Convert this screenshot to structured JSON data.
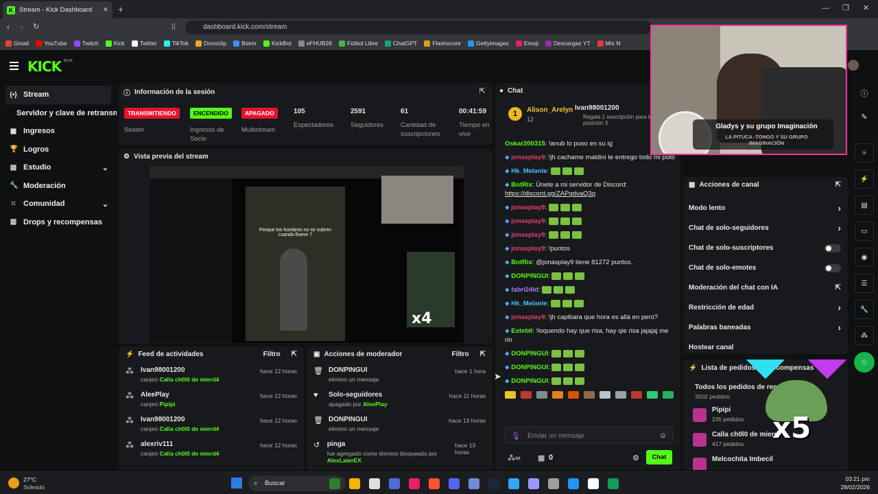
{
  "browser": {
    "tab_title": "Stream - Kick Dashboard",
    "url": "dashboard.kick.com/stream",
    "bookmarks": [
      "Gmail",
      "YouTube",
      "Twitch",
      "Kick",
      "Twitter",
      "TikTok",
      "Donoclip",
      "Botrix",
      "KickBot",
      "eFHUB26",
      "Fútbol Libre",
      "ChatGPT",
      "Flashscore",
      "Gettyimages",
      "Emoji",
      "Descargas YT",
      "Mix N"
    ]
  },
  "brand": {
    "logo": "KICK",
    "beta": "BETA"
  },
  "sidebar": {
    "items": [
      {
        "label": "Stream",
        "icon": "(•)"
      },
      {
        "label": "Servidor y clave de retransmisión",
        "icon": ""
      },
      {
        "label": "Ingresos",
        "icon": "▦"
      },
      {
        "label": "Logros",
        "icon": "🏆"
      },
      {
        "label": "Estudio",
        "icon": "▤"
      },
      {
        "label": "Moderación",
        "icon": "🔧"
      },
      {
        "label": "Comunidad",
        "icon": "⁙"
      },
      {
        "label": "Drops y recompensas",
        "icon": "▥"
      }
    ]
  },
  "session": {
    "title": "Información de la sesión",
    "stats": [
      {
        "badge": "TRANSMITIENDO",
        "label": "Sesión"
      },
      {
        "badge": "ENCENDIDO",
        "label": "Ingresos de Socio"
      },
      {
        "badge": "APAGADO",
        "label": "Multistream"
      },
      {
        "value": "105",
        "label": "Espectadores"
      },
      {
        "value": "2591",
        "label": "Seguidores"
      },
      {
        "value": "61",
        "label": "Cantidad de suscripciones"
      },
      {
        "value": "00:41:59",
        "label": "Tiempo en vivo"
      }
    ]
  },
  "preview": {
    "title": "Vista previa del stream",
    "caption": "Porque los hombres no se cubren cuando llueve ?",
    "overlay": "x4"
  },
  "feed": {
    "title": "Feed de actividades",
    "filter": "Filtro",
    "items": [
      {
        "user": "Ivan98001200",
        "action": "canjeó",
        "reward": "Calla ch0l0 de mierd4",
        "time": "hace 12 horas"
      },
      {
        "user": "AleePlay",
        "action": "canjeó",
        "reward": "Pipipi",
        "time": "hace 12 horas"
      },
      {
        "user": "Ivan98001200",
        "action": "canjeó",
        "reward": "Calla ch0l0 de mierd4",
        "time": "hace 12 horas"
      },
      {
        "user": "alexriv111",
        "action": "canjeó",
        "reward": "Calla ch0l0 de mierd4",
        "time": "hace 12 horas"
      }
    ]
  },
  "mod": {
    "title": "Acciones de moderador",
    "filter": "Filtro",
    "items": [
      {
        "title": "DONPINGUI",
        "sub": "eliminó un mensaje",
        "by": "",
        "time": "hace 1 hora",
        "icon": "🗑"
      },
      {
        "title": "Solo-seguidores",
        "sub": "apagado por",
        "by": "AleePlay",
        "time": "hace 11 horas",
        "icon": "♥"
      },
      {
        "title": "DONPINGUI",
        "sub": "eliminó un mensaje",
        "by": "",
        "time": "hace 13 horas",
        "icon": "🗑"
      },
      {
        "title": "pinga",
        "sub": "fue agregado como término bloqueado por",
        "by": "AlexLaterEX",
        "time": "hace 13 horas",
        "icon": "↺"
      }
    ]
  },
  "chat": {
    "title": "Chat",
    "top1": "Alison_Arelyn",
    "top1_count": "12",
    "top2": "Ivan98001200",
    "top2_note": "Regala 1 suscripción para tomar la posición 3",
    "placeholder": "Enviar un mensaje",
    "send": "Chat",
    "count": "0",
    "lines": [
      {
        "user": "Oskar200315",
        "color": "#53fc18",
        "text": ": !anub lo puso en su ig"
      },
      {
        "user": "jonasplay9",
        "color": "#e0446a",
        "text": ": !jh cachame maldini te entrego todo mi poto"
      },
      {
        "user": "Hk_Melanie",
        "color": "#3fc4ff",
        "text": ":"
      },
      {
        "user": "BotRix",
        "color": "#53fc18",
        "text": ": Únete a mi servidor de Discord:",
        "link": "https://discord.gg/ZAPqdvaQ3q"
      },
      {
        "user": "jonasplay9",
        "color": "#e0446a",
        "text": ":"
      },
      {
        "user": "jonasplay9",
        "color": "#e0446a",
        "text": ":"
      },
      {
        "user": "jonasplay9",
        "color": "#e0446a",
        "text": ":"
      },
      {
        "user": "jonasplay9",
        "color": "#e0446a",
        "text": ": !puntos"
      },
      {
        "user": "BotRix",
        "color": "#53fc18",
        "text": ": @jonasplay9 tiene 81272 puntos."
      },
      {
        "user": "DONPINGUI",
        "color": "#53fc18",
        "text": ":"
      },
      {
        "user": "fabri24ld",
        "color": "#b07cff",
        "text": ":"
      },
      {
        "user": "Hk_Melanie",
        "color": "#3fc4ff",
        "text": ":"
      },
      {
        "user": "jonasplay9",
        "color": "#e0446a",
        "text": ": !jh capibara que hora es allá en perú?"
      },
      {
        "user": "Estebii",
        "color": "#53fc18",
        "text": ": !loquendo hay que risa, hay qie risa jajajaj me rio"
      },
      {
        "user": "DONPINGUI",
        "color": "#53fc18",
        "text": ":"
      },
      {
        "user": "DONPINGUI",
        "color": "#53fc18",
        "text": ":"
      },
      {
        "user": "DONPINGUI",
        "color": "#53fc18",
        "text": ":"
      }
    ]
  },
  "webcam": {
    "song": "Gladys y su grupo Imaginación",
    "sub": "LA PITUCA -TONGO Y SU GRUPO IMAGINACIÓN"
  },
  "channel": {
    "title": "Acciones de canal",
    "items": [
      {
        "label": "Modo lento",
        "type": "arrow"
      },
      {
        "label": "Chat de solo-seguidores",
        "type": "arrow"
      },
      {
        "label": "Chat de solo-suscriptores",
        "type": "toggle"
      },
      {
        "label": "Chat de solo-emotes",
        "type": "toggle"
      },
      {
        "label": "Moderación del chat con IA",
        "type": "ext"
      },
      {
        "label": "Restricción de edad",
        "type": "arrow"
      },
      {
        "label": "Palabras baneadas",
        "type": "arrow"
      },
      {
        "label": "Hostear canal",
        "type": "none"
      }
    ]
  },
  "requests": {
    "title": "Lista de pedidos de Recompensas",
    "all": "Todos los pedidos de recompensas",
    "all_count": "3502 pedidos",
    "items": [
      {
        "name": "Pipipi",
        "count": "235 pedidos"
      },
      {
        "name": "Calla ch0l0 de mierd4",
        "count": "417 pedidos"
      },
      {
        "name": "Melcochita Imbecil",
        "count": ""
      }
    ],
    "overlay": "x5"
  },
  "taskbar": {
    "temp": "27°C",
    "weather": "Soleado",
    "search": "Buscar",
    "time": "03:21 pm",
    "date": "28/02/2026"
  }
}
